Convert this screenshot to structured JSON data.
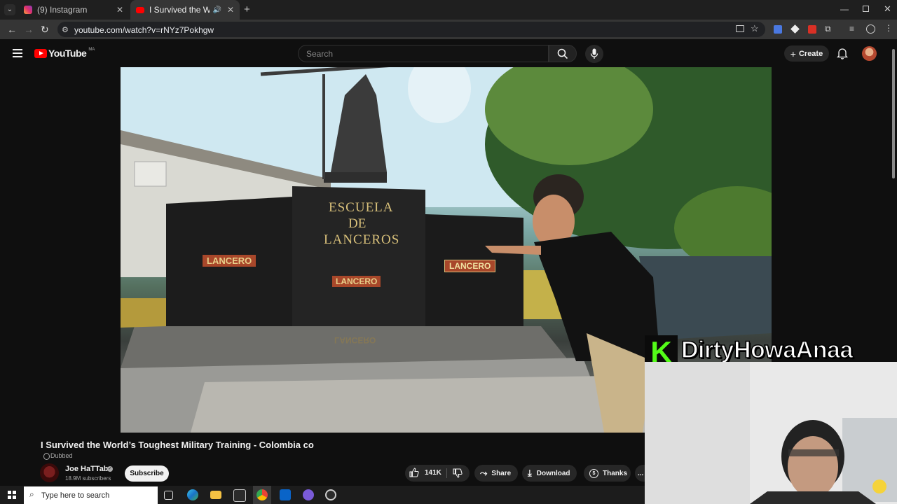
{
  "browser": {
    "tabs": [
      {
        "title": "(9) Instagram",
        "active": false
      },
      {
        "title": "I Survived the World's Toug",
        "active": true
      }
    ],
    "url": "youtube.com/watch?v=rNYz7Pokhgw"
  },
  "youtube": {
    "logo_text": "YouTube",
    "logo_region": "MA",
    "search_placeholder": "Search",
    "create_label": "Create"
  },
  "video": {
    "scene_text": {
      "escuela": "ESCUELA",
      "de": "DE",
      "lanceros": "LANCEROS",
      "plaque_left": "LANCERO",
      "plaque_center": "LANCERO",
      "plaque_right": "LANCERO",
      "reflection": "LANCERO"
    },
    "title": "I Survived the World’s Toughest Military Training - Colombia co",
    "dubbed_label": "Dubbed",
    "channel_name": "Joe HaTTab",
    "subscribers": "18.9M subscribers",
    "subscribe_label": "Subscribe",
    "likes": "141K",
    "share_label": "Share",
    "download_label": "Download",
    "thanks_label": "Thanks",
    "more_label": "..."
  },
  "stream_overlay": {
    "logo_letter": "K",
    "streamer_name": "DirtyHowaAnaa"
  },
  "taskbar": {
    "search_placeholder": "Type here to search"
  },
  "colors": {
    "yt_red": "#ff0000",
    "kick_green": "#53fc18",
    "page_bg": "#0f0f0f"
  }
}
